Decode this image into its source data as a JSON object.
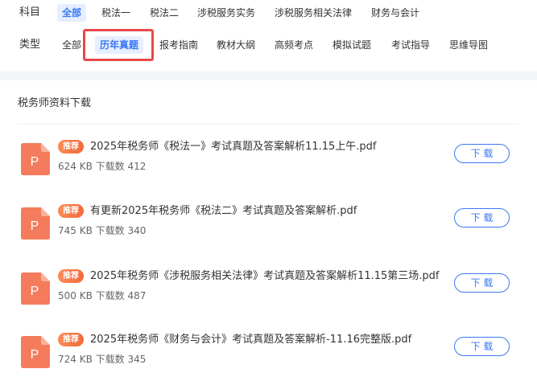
{
  "filters": {
    "subject": {
      "label": "科目",
      "options": [
        "全部",
        "税法一",
        "税法二",
        "涉税服务实务",
        "涉税服务相关法律",
        "财务与会计"
      ],
      "active": "全部"
    },
    "type": {
      "label": "类型",
      "options": [
        "全部",
        "历年真题",
        "报考指南",
        "教材大纲",
        "高频考点",
        "模拟试题",
        "考试指导",
        "思维导图"
      ],
      "active": "历年真题"
    }
  },
  "section": {
    "title": "税务师资料下载"
  },
  "files": [
    {
      "badge": "推荐",
      "name": "2025年税务师《税法一》考试真题及答案解析11.15上午.pdf",
      "size": "624 KB",
      "downloads": "下载数 412",
      "button": "下 载"
    },
    {
      "badge": "推荐",
      "name": "有更新2025年税务师《税法二》考试真题及答案解析.pdf",
      "size": "745 KB",
      "downloads": "下载数 340",
      "button": "下 载"
    },
    {
      "badge": "推荐",
      "name": "2025年税务师《涉税服务相关法律》考试真题及答案解析11.15第三场.pdf",
      "size": "500 KB",
      "downloads": "下载数 487",
      "button": "下 载"
    },
    {
      "badge": "推荐",
      "name": "2025年税务师《财务与会计》考试真题及答案解析-11.16完整版.pdf",
      "size": "724 KB",
      "downloads": "下载数 345",
      "button": "下 载"
    }
  ],
  "icons": {
    "file": "pdf-file-icon",
    "file_glyph": "P"
  },
  "colors": {
    "accent": "#3a78f2",
    "badge": "#f26a3b",
    "icon": "#f47c5c",
    "highlight": "#e8484a"
  }
}
